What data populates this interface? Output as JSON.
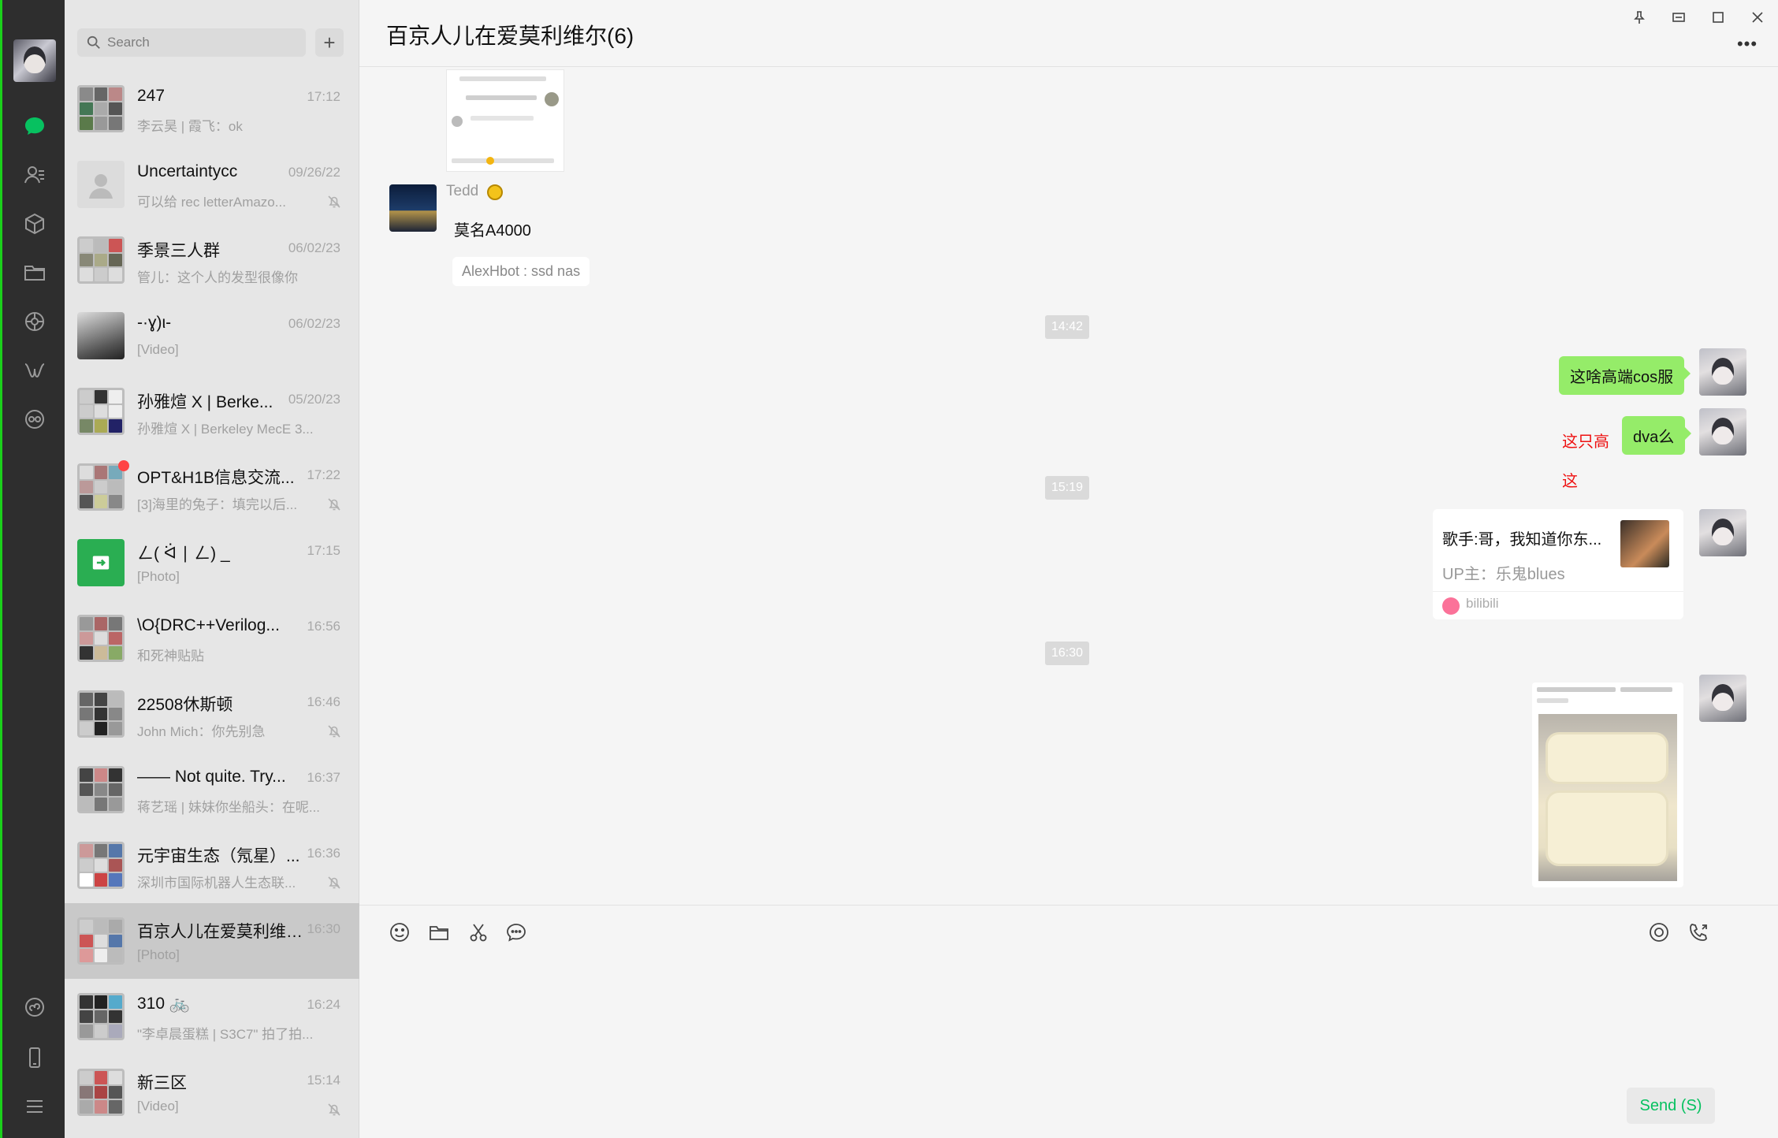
{
  "search": {
    "placeholder": "Search",
    "add_label": "+"
  },
  "conversations": [
    {
      "name": "247",
      "time": "17:12",
      "preview": "李云昊 | 霞飞：ok",
      "muted": false
    },
    {
      "name": "Uncertaintycc",
      "time": "09/26/22",
      "preview": "可以给 rec letterAmazo...",
      "muted": true
    },
    {
      "name": "季景三人群",
      "time": "06/02/23",
      "preview": "管儿：这个人的发型很像你",
      "muted": false
    },
    {
      "name": "-·ɣ)ι-",
      "time": "06/02/23",
      "preview": "[Video]",
      "muted": false
    },
    {
      "name": "孙雅煊 X | Berke...",
      "time": "05/20/23",
      "preview": "孙雅煊 X | Berkeley MecE 3...",
      "muted": false
    },
    {
      "name": "OPT&H1B信息交流...",
      "time": "17:22",
      "preview": "[3]海里的兔子：填完以后...",
      "muted": true
    },
    {
      "name": "ㄥ( ᐛ ∣ ㄥ) _",
      "time": "17:15",
      "preview": "[Photo]",
      "muted": false
    },
    {
      "name": "\\O{DRC++Verilog...",
      "time": "16:56",
      "preview": "和死神贴贴",
      "muted": false
    },
    {
      "name": "22508休斯顿",
      "time": "16:46",
      "preview": "John Mich：你先别急",
      "muted": true
    },
    {
      "name": "—— Not quite. Try...",
      "time": "16:37",
      "preview": "蒋艺瑶 | 妹妹你坐船头：在呢...",
      "muted": false
    },
    {
      "name": "元宇宙生态（氖星）...",
      "time": "16:36",
      "preview": "深圳市国际机器人生态联...",
      "muted": true
    },
    {
      "name": "百京人儿在爱莫利维尔...",
      "time": "16:30",
      "preview": "[Photo]",
      "muted": false
    },
    {
      "name": "310 🚲",
      "time": "16:24",
      "preview": "\"李卓晨蛋糕 | S3C7\" 拍了拍...",
      "muted": false
    },
    {
      "name": "新三区",
      "time": "15:14",
      "preview": "[Video]",
      "muted": true
    }
  ],
  "chat": {
    "title": "百京人儿在爱莫利维尔(6)",
    "more_label": "•••",
    "sender_faded": "Tedd",
    "sender_name": "莫名A4000",
    "incoming_text": "AlexHbot : ssd nas",
    "times": [
      "14:42",
      "15:19",
      "16:30"
    ],
    "out_msg_1": "这啥高端cos服",
    "out_msg_2": "dva么",
    "stray_1": "这只高",
    "stray_2": "这",
    "link_title": "歌手:哥，我知道你东...",
    "link_sub": "UP主：乐鬼blues",
    "link_source": "bilibili",
    "send_label": "Send (S)"
  },
  "colors": {
    "rail_bg": "#2e2e2e",
    "list_bg": "#e6e6e6",
    "chat_bg": "#f5f5f5",
    "bubble_out": "#95ec69",
    "accent": "#07c160"
  }
}
